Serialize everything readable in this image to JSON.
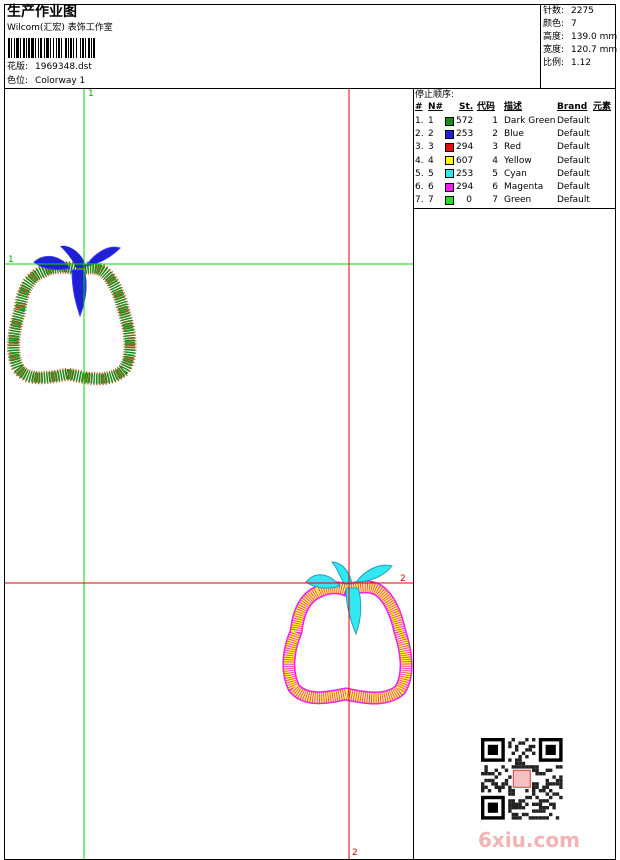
{
  "header": {
    "title": "生产作业图",
    "subtitle": "Wilcom(汇宏) 表饰工作室",
    "design_label": "花版:",
    "design_value": "1969348.dst",
    "colorway_label": "色位:",
    "colorway_value": "Colorway 1"
  },
  "stats": {
    "stitches": {
      "label": "针数:",
      "value": "2275"
    },
    "colors": {
      "label": "颜色:",
      "value": "7"
    },
    "height": {
      "label": "高度:",
      "value": "139.0 mm"
    },
    "width": {
      "label": "宽度:",
      "value": "120.7 mm"
    },
    "scale": {
      "label": "比例:",
      "value": "1.12"
    }
  },
  "sequence": {
    "title": "停止顺序:",
    "columns": [
      "#",
      "N#",
      "St.",
      "代码",
      "描述",
      "Brand",
      "元素"
    ],
    "rows": [
      {
        "num": "1.",
        "n": "1",
        "color": "#1a8c1a",
        "st": "572",
        "code": "1",
        "desc": "Dark Green",
        "brand": "Default"
      },
      {
        "num": "2.",
        "n": "2",
        "color": "#1f1fd6",
        "st": "253",
        "code": "2",
        "desc": "Blue",
        "brand": "Default"
      },
      {
        "num": "3.",
        "n": "3",
        "color": "#e01010",
        "st": "294",
        "code": "3",
        "desc": "Red",
        "brand": "Default"
      },
      {
        "num": "4.",
        "n": "4",
        "color": "#ffff00",
        "st": "607",
        "code": "4",
        "desc": "Yellow",
        "brand": "Default"
      },
      {
        "num": "5.",
        "n": "5",
        "color": "#30e8f0",
        "st": "253",
        "code": "5",
        "desc": "Cyan",
        "brand": "Default"
      },
      {
        "num": "6.",
        "n": "6",
        "color": "#f020f0",
        "st": "294",
        "code": "6",
        "desc": "Magenta",
        "brand": "Default"
      },
      {
        "num": "7.",
        "n": "7",
        "color": "#20e020",
        "st": "0",
        "code": "7",
        "desc": "Green",
        "brand": "Default"
      }
    ]
  },
  "markers": {
    "green_top": "1",
    "green_left": "1",
    "red_right": "2",
    "red_bottom": "2"
  },
  "colors": {
    "guide_green": "#00dd00",
    "guide_red": "#e00000"
  },
  "watermark": {
    "text": "6xiu.com",
    "qr_icon": "qr-code-icon"
  }
}
